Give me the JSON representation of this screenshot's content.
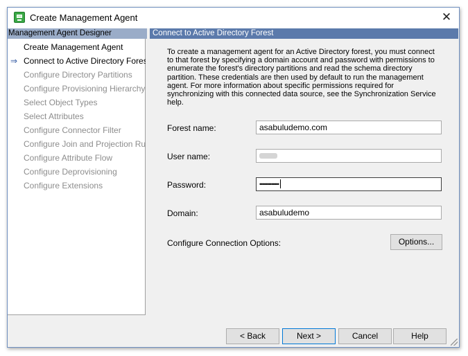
{
  "window": {
    "title": "Create Management Agent",
    "close_symbol": "✕"
  },
  "left_panel": {
    "header": "Management Agent Designer",
    "current_marker": "⇒",
    "steps": [
      {
        "label": "Create Management Agent",
        "state": "done"
      },
      {
        "label": "Connect to Active Directory Forest",
        "state": "current"
      },
      {
        "label": "Configure Directory Partitions",
        "state": "disabled"
      },
      {
        "label": "Configure Provisioning Hierarchy",
        "state": "disabled"
      },
      {
        "label": "Select Object Types",
        "state": "disabled"
      },
      {
        "label": "Select Attributes",
        "state": "disabled"
      },
      {
        "label": "Configure Connector Filter",
        "state": "disabled"
      },
      {
        "label": "Configure Join and Projection Rules",
        "state": "disabled"
      },
      {
        "label": "Configure Attribute Flow",
        "state": "disabled"
      },
      {
        "label": "Configure Deprovisioning",
        "state": "disabled"
      },
      {
        "label": "Configure Extensions",
        "state": "disabled"
      }
    ]
  },
  "right_panel": {
    "header": "Connect to Active Directory Forest",
    "intro": "To create a management agent for an Active Directory forest, you must connect to that forest by specifying a domain account and password with permissions to enumerate the forest's directory partitions and read the schema directory partition. These credentials are then used by default to run the management agent. For more information about specific permissions required for synchronizing with this connected data source, see the Synchronization Service help.",
    "fields": {
      "forest_name": {
        "label": "Forest name:",
        "value": "asabuludemo.com"
      },
      "user_name": {
        "label": "User name:",
        "value": ""
      },
      "password": {
        "label": "Password:",
        "value": "•••••••••••••"
      },
      "domain": {
        "label": "Domain:",
        "value": "asabuludemo"
      }
    },
    "connection_options": {
      "label": "Configure Connection Options:",
      "button": "Options..."
    }
  },
  "footer": {
    "back": "< Back",
    "next": "Next >",
    "cancel": "Cancel",
    "help": "Help"
  },
  "colors": {
    "left_header_bg": "#9aacc8",
    "right_header_bg": "#5b7aab",
    "disabled_text": "#8d8d8d",
    "app_icon": "#3aa845"
  },
  "icons": {
    "app": "management-agent-app-icon",
    "current_step": "right-arrow-icon",
    "close": "close-icon"
  }
}
